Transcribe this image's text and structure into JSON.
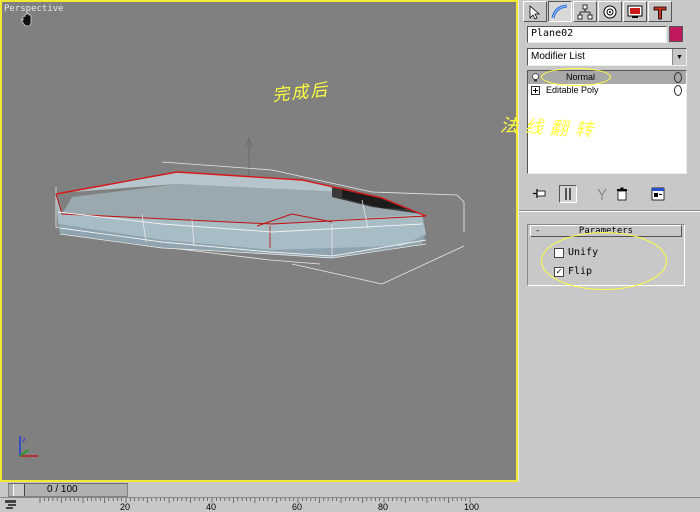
{
  "viewport": {
    "label": "Perspective",
    "annotation_done": "完成后",
    "annotation_flip": "法线翻转"
  },
  "timeslider": {
    "label": "0 / 100",
    "ticks": [
      "20",
      "40",
      "60",
      "80",
      "100"
    ]
  },
  "panel": {
    "tabs": [
      {
        "name": "create-tab",
        "icon": "create-icon"
      },
      {
        "name": "modify-tab",
        "icon": "modify-icon"
      },
      {
        "name": "hierarchy-tab",
        "icon": "hierarchy-icon"
      },
      {
        "name": "motion-tab",
        "icon": "motion-icon"
      },
      {
        "name": "display-tab",
        "icon": "display-icon"
      },
      {
        "name": "utilities-tab",
        "icon": "utilities-icon"
      }
    ],
    "object_name": "Plane02",
    "object_color": "#c0185c",
    "modifier_list": "Modifier List",
    "stack": [
      {
        "label": "Normal",
        "selected": true
      },
      {
        "label": "Editable Poly",
        "selected": false
      }
    ],
    "rollout_title": "Parameters",
    "rollout_collapse": "-",
    "options": {
      "unify": {
        "label": "Unify",
        "checked": false
      },
      "flip": {
        "label": "Flip",
        "checked": true
      }
    }
  }
}
